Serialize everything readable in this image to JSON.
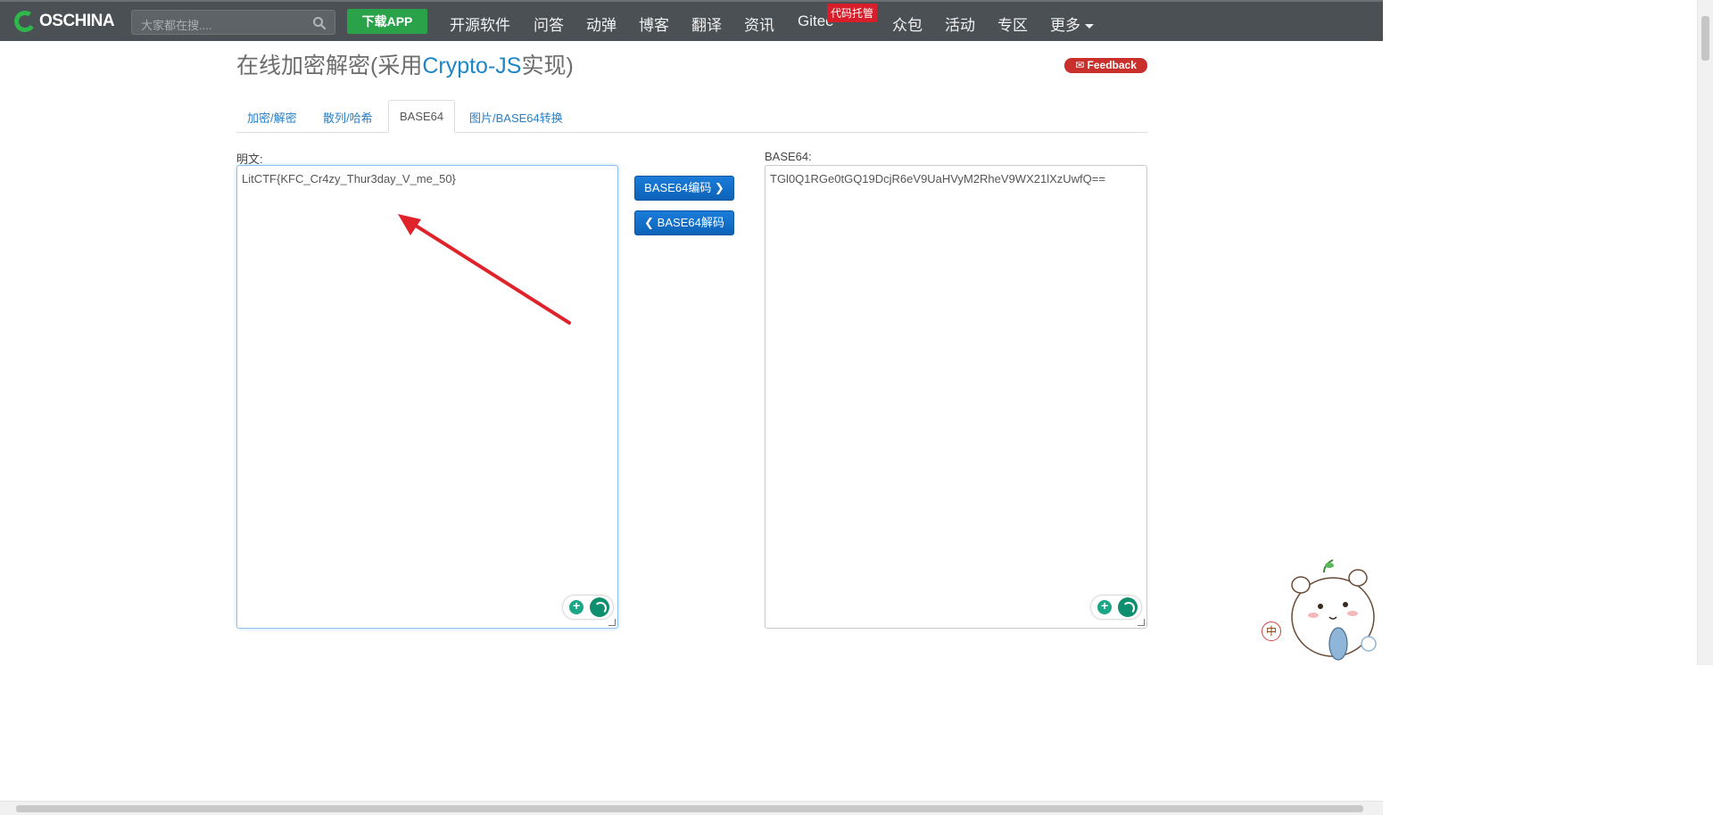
{
  "header": {
    "logo_text": "OSCHINA",
    "search_placeholder": "大家都在搜....",
    "app_button": "下载APP",
    "nav_items": [
      "开源软件",
      "问答",
      "动弹",
      "博客",
      "翻译",
      "资讯",
      "Gitee",
      "众包",
      "活动",
      "专区",
      "更多"
    ],
    "gitee_badge": "代码托管"
  },
  "page": {
    "title_prefix": "在线加密解密(采用",
    "title_accent": "Crypto-JS",
    "title_suffix": "实现)",
    "feedback_label": "✉ Feedback"
  },
  "tabs": [
    {
      "label": "加密/解密",
      "active": false
    },
    {
      "label": "散列/哈希",
      "active": false
    },
    {
      "label": "BASE64",
      "active": true
    },
    {
      "label": "图片/BASE64转换",
      "active": false
    }
  ],
  "left_panel": {
    "label": "明文:",
    "value": "LitCTF{KFC_Cr4zy_Thur3day_V_me_50}"
  },
  "right_panel": {
    "label": "BASE64:",
    "value": "TGl0Q1RGe0tGQ19DcjR6eV9UaHVyM2RheV9WX21lXzUwfQ=="
  },
  "buttons": {
    "encode": "BASE64编码 ❯",
    "decode": "❮ BASE64解码"
  },
  "mascot": {
    "badge": "中"
  },
  "colors": {
    "nav_bg": "#4b5054",
    "accent": "#1e86c6",
    "download_btn": "#2aa24a",
    "primary_btn": "#0d63b8",
    "badge_red": "#d81e2a"
  }
}
